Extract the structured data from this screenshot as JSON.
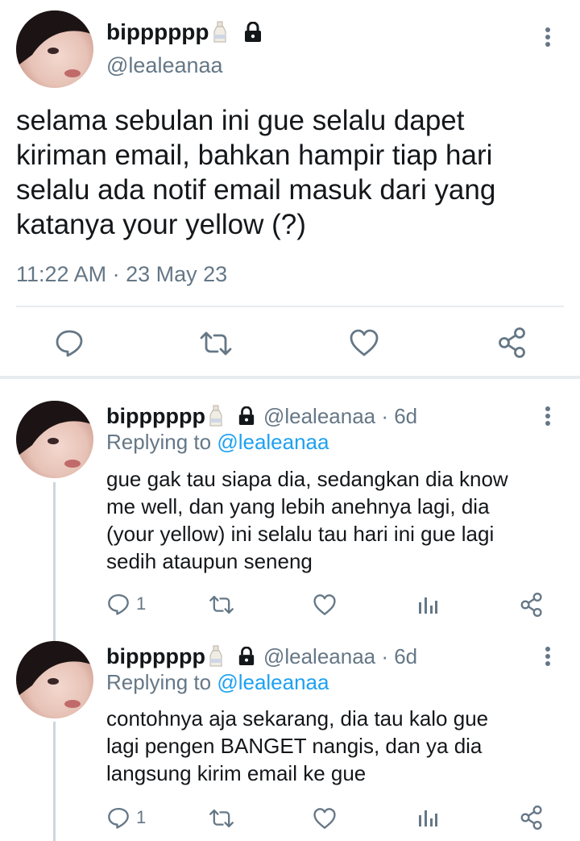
{
  "main_tweet": {
    "display_name": "bipppppp",
    "handle": "@lealeanaa",
    "text_lines": [
      "selama sebulan ini gue selalu dapet",
      "kiriman email, bahkan hampir tiap hari",
      "selalu ada notif email masuk dari yang",
      "katanya your yellow (?)"
    ],
    "timestamp": "11:22 AM · 23 May 23",
    "actions": [
      "reply-icon",
      "retweet-icon",
      "like-icon",
      "share-icon"
    ]
  },
  "replies": [
    {
      "display_name": "bipppppp",
      "handle_time": "@lealeanaa · 6d",
      "replying_prefix": "Replying to",
      "replying_to": "@lealeanaa",
      "text_lines": [
        "gue gak tau siapa dia, sedangkan dia know",
        "me well, dan yang lebih anehnya lagi, dia",
        "(your yellow) ini selalu tau hari ini gue lagi",
        "sedih ataupun seneng"
      ],
      "reply_count": "1"
    },
    {
      "display_name": "bipppppp",
      "handle_time": "@lealeanaa · 6d",
      "replying_prefix": "Replying to",
      "replying_to": "@lealeanaa",
      "text_lines": [
        "contohnya aja sekarang, dia tau kalo gue",
        "lagi pengen BANGET nangis, dan ya dia",
        "langsung kirim email ke gue"
      ],
      "reply_count": "1"
    }
  ],
  "colors": {
    "text": "#14171a",
    "secondary": "#657786",
    "link": "#1da1f2",
    "divider": "#e6ecf0"
  }
}
